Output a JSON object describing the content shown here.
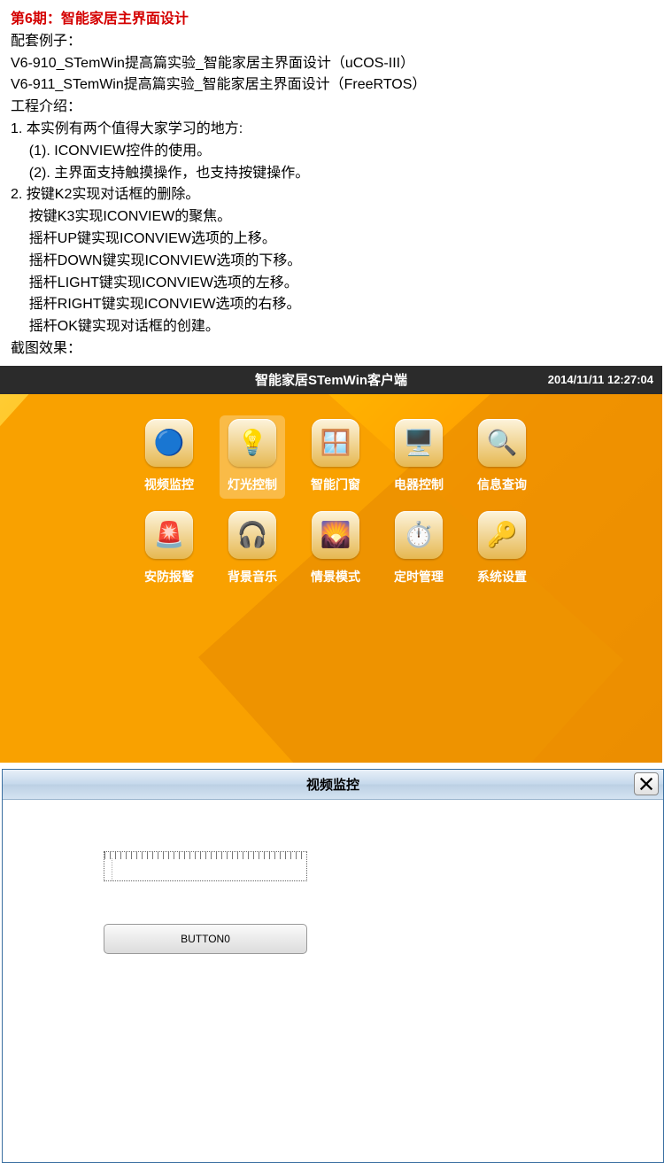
{
  "section_title": "第6期：智能家居主界面设计",
  "lines": {
    "l1": "配套例子：",
    "l2": "V6-910_STemWin提高篇实验_智能家居主界面设计（uCOS-III）",
    "l3": "V6-911_STemWin提高篇实验_智能家居主界面设计（FreeRTOS）",
    "l4": "工程介绍：",
    "l5": "1. 本实例有两个值得大家学习的地方:",
    "l6": "(1). ICONVIEW控件的使用。",
    "l7": "(2). 主界面支持触摸操作，也支持按键操作。",
    "l8": "2. 按键K2实现对话框的删除。",
    "l9": "按键K3实现ICONVIEW的聚焦。",
    "l10": "摇杆UP键实现ICONVIEW选项的上移。",
    "l11": "摇杆DOWN键实现ICONVIEW选项的下移。",
    "l12": "摇杆LIGHT键实现ICONVIEW选项的左移。",
    "l13": "摇杆RIGHT键实现ICONVIEW选项的右移。",
    "l14": "摇杆OK键实现对话框的创建。",
    "l15": "截图效果："
  },
  "home_ui": {
    "statusbar_title": "智能家居STemWin客户端",
    "clock": "2014/11/11  12:27:04",
    "icons": [
      {
        "id": "video-monitor",
        "label": "视频监控",
        "glyph": "🔵",
        "selected": false
      },
      {
        "id": "light-control",
        "label": "灯光控制",
        "glyph": "💡",
        "selected": true
      },
      {
        "id": "smart-doorwin",
        "label": "智能门窗",
        "glyph": "🪟",
        "selected": false
      },
      {
        "id": "appliance-ctrl",
        "label": "电器控制",
        "glyph": "🖥️",
        "selected": false
      },
      {
        "id": "info-query",
        "label": "信息查询",
        "glyph": "🔍",
        "selected": false
      },
      {
        "id": "security-alarm",
        "label": "安防报警",
        "glyph": "🚨",
        "selected": false
      },
      {
        "id": "bg-music",
        "label": "背景音乐",
        "glyph": "🎧",
        "selected": false
      },
      {
        "id": "scene-mode",
        "label": "情景模式",
        "glyph": "🌄",
        "selected": false
      },
      {
        "id": "timer-manage",
        "label": "定时管理",
        "glyph": "⏱️",
        "selected": false
      },
      {
        "id": "system-settings",
        "label": "系统设置",
        "glyph": "🔑",
        "selected": false
      }
    ]
  },
  "dialog": {
    "title": "视频监控",
    "edit_value": "",
    "button0_label": "BUTTON0"
  }
}
